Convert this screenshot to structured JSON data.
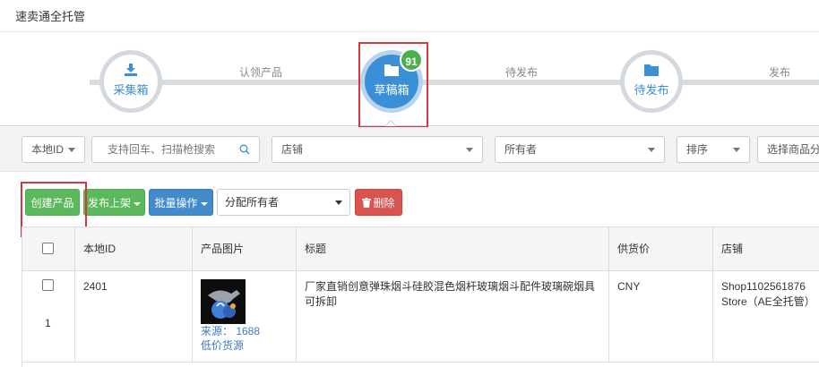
{
  "header": {
    "title": "速卖通全托管"
  },
  "steps": {
    "items": [
      {
        "label": "采集箱"
      },
      {
        "label": "草稿箱",
        "badge": "91",
        "active": true
      },
      {
        "label": "待发布"
      }
    ],
    "connectors": [
      "认领产品",
      "待发布",
      "发布"
    ]
  },
  "filters": {
    "local_id": "本地ID",
    "search_placeholder": "支持回车、扫描枪搜索",
    "shop": "店铺",
    "owner": "所有者",
    "sort": "排序",
    "category": "选择商品分类"
  },
  "toolbar": {
    "create": "创建产品",
    "publish": "发布上架",
    "batch": "批量操作",
    "assign": "分配所有者",
    "delete": "删除"
  },
  "table": {
    "headers": [
      "本地ID",
      "产品图片",
      "标题",
      "供货价",
      "店铺"
    ],
    "rows": [
      {
        "index": "1",
        "local_id": "2401",
        "source": "来源： 1688",
        "source_tag": "低价货源",
        "title": "厂家直销创意弹珠烟斗硅胶混色烟杆玻璃烟斗配件玻璃碗烟具可拆卸",
        "price": "CNY",
        "shop": "Shop1102561876 Store（AE全托管）"
      }
    ]
  },
  "colors": {
    "accent": "#3b8fd6",
    "green": "#5cb85c",
    "blue": "#428bca",
    "red": "#d9534f",
    "badge": "#4cae4c",
    "highlight": "#d9363e"
  }
}
